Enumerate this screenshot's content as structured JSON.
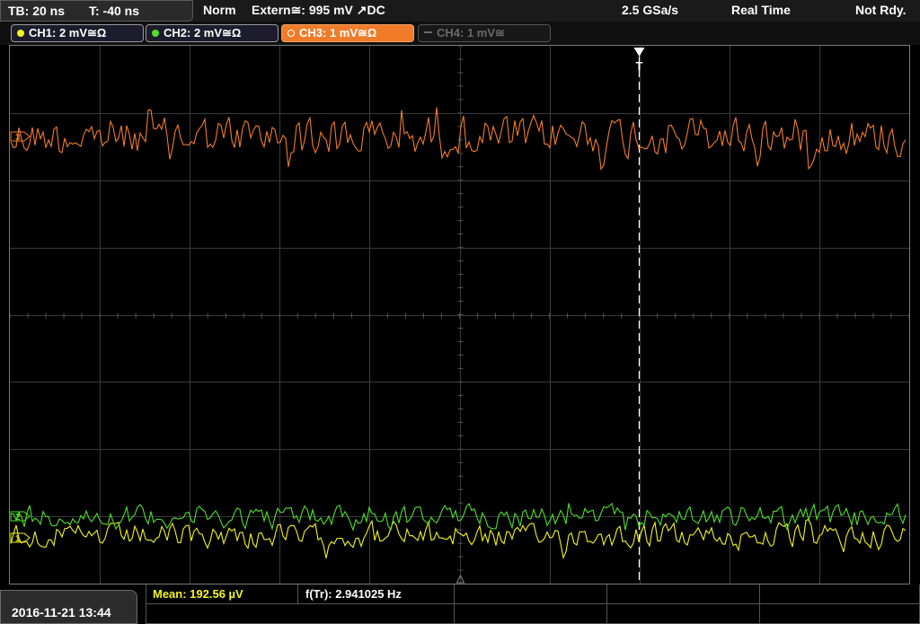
{
  "topbar": {
    "timebase": "TB: 20 ns",
    "trigger_offset": "T: -40 ns",
    "mode": "Norm",
    "trigger_source": "Extern≅: 995 mV ↗DC",
    "sample_rate": "2.5 GSa/s",
    "acquisition": "Real Time",
    "state": "Not Rdy."
  },
  "channels": [
    {
      "label": "CH1: 2 mV≅Ω",
      "color": "#f4f41c",
      "state": "on"
    },
    {
      "label": "CH2: 2 mV≅Ω",
      "color": "#4ee02a",
      "state": "on"
    },
    {
      "label": "CH3: 1 mV≅Ω",
      "color": "#f07c2a",
      "state": "active"
    },
    {
      "label": "CH4: 1 mV≅",
      "color": "#6a6a6a",
      "state": "off"
    }
  ],
  "screen": {
    "trigger_marker": "T",
    "grid_color": "#3a3a3a",
    "traces": [
      {
        "name": "CH3",
        "color": "#f07c2a",
        "label": "3"
      },
      {
        "name": "CH2",
        "color": "#4ee02a",
        "label": "2"
      },
      {
        "name": "CH1",
        "color": "#f4f41c",
        "label": "1"
      }
    ]
  },
  "datetime": "2016-11-21 13:44",
  "measurements": {
    "mean": "Mean: 192.56 µV",
    "freq": "f(Tr): 2.941025 Hz"
  }
}
